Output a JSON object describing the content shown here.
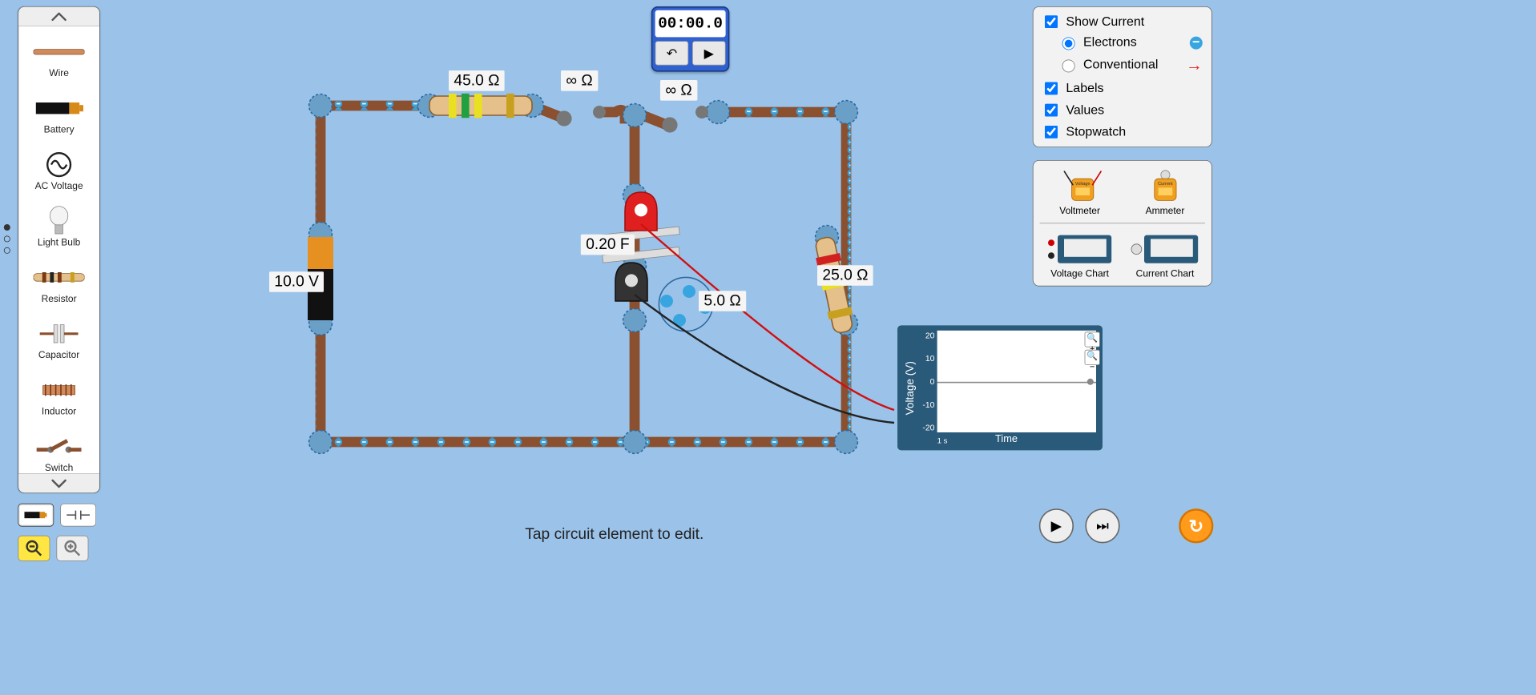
{
  "palette": {
    "items": [
      {
        "id": "wire",
        "label": "Wire"
      },
      {
        "id": "battery",
        "label": "Battery"
      },
      {
        "id": "ac-voltage",
        "label": "AC Voltage"
      },
      {
        "id": "light-bulb",
        "label": "Light Bulb"
      },
      {
        "id": "resistor",
        "label": "Resistor"
      },
      {
        "id": "capacitor",
        "label": "Capacitor"
      },
      {
        "id": "inductor",
        "label": "Inductor"
      },
      {
        "id": "switch",
        "label": "Switch"
      }
    ]
  },
  "stopwatch": {
    "time": "00:00.0"
  },
  "options": {
    "show_current": {
      "label": "Show Current",
      "checked": true
    },
    "current_type": {
      "electrons": {
        "label": "Electrons",
        "selected": true
      },
      "conventional": {
        "label": "Conventional",
        "selected": false
      }
    },
    "labels": {
      "label": "Labels",
      "checked": true
    },
    "values": {
      "label": "Values",
      "checked": true
    },
    "stopwatch": {
      "label": "Stopwatch",
      "checked": true
    }
  },
  "meters": {
    "voltmeter": "Voltmeter",
    "ammeter": "Ammeter",
    "voltage_chart": "Voltage Chart",
    "current_chart": "Current Chart"
  },
  "circuit": {
    "battery_value": "10.0 V",
    "resistor1_value": "45.0 Ω",
    "switch1_value": "∞ Ω",
    "switch2_value": "∞ Ω",
    "capacitor_value": "0.20 F",
    "resistor_internal_value": "5.0 Ω",
    "resistor2_value": "25.0 Ω"
  },
  "chart": {
    "ylabel": "Voltage (V)",
    "xlabel": "Time",
    "xunit": "1 s",
    "ticks": [
      "20",
      "10",
      "0",
      "-10",
      "-20"
    ]
  },
  "tip": "Tap circuit element to edit.",
  "chart_data": {
    "type": "line",
    "title": "Voltage",
    "xlabel": "Time",
    "ylabel": "Voltage (V)",
    "ylim": [
      -20,
      20
    ],
    "series": [
      {
        "name": "Voltage",
        "x": [
          0
        ],
        "y": [
          0
        ]
      }
    ]
  }
}
